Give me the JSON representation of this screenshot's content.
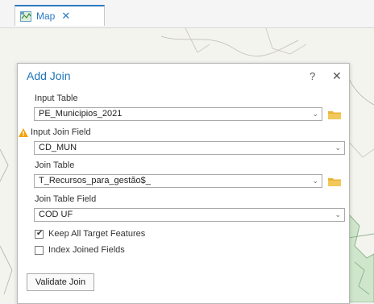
{
  "tab": {
    "label": "Map",
    "close_glyph": "✕",
    "icon": "map-tab-icon"
  },
  "dialog": {
    "title": "Add Join",
    "help_glyph": "?",
    "close_glyph": "✕",
    "input_table": {
      "label": "Input Table",
      "value": "PE_Municipios_2021"
    },
    "input_join_field": {
      "label": "Input Join Field",
      "value": "CD_MUN",
      "warning": true
    },
    "join_table": {
      "label": "Join Table",
      "value": "T_Recursos_para_gestão$_"
    },
    "join_table_field": {
      "label": "Join Table Field",
      "value": "COD UF"
    },
    "keep_all": {
      "label": "Keep All Target Features",
      "checked": true
    },
    "index_joined": {
      "label": "Index Joined Fields",
      "checked": false
    },
    "validate_button": "Validate Join"
  },
  "colors": {
    "accent": "#1f74b8",
    "folder": "#e8b43a",
    "warning": "#f0a30a"
  }
}
